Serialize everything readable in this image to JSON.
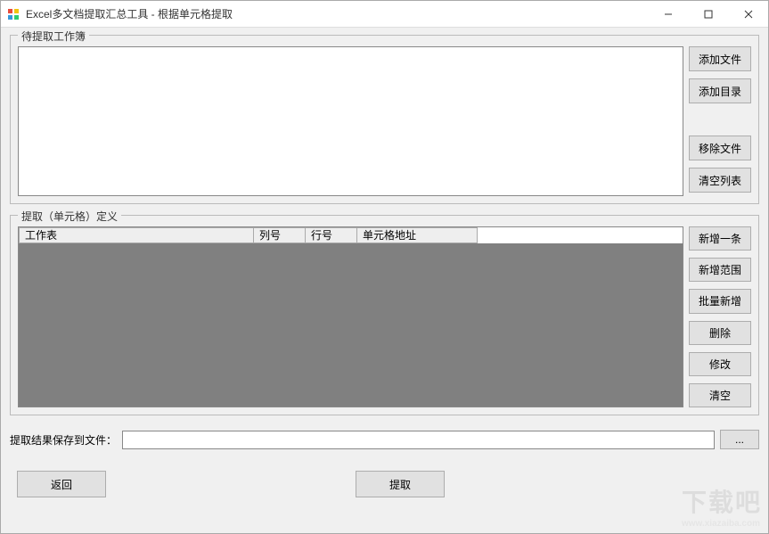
{
  "window": {
    "title": "Excel多文档提取汇总工具 - 根据单元格提取"
  },
  "group_workbooks": {
    "legend": "待提取工作簿",
    "buttons": {
      "add_file": "添加文件",
      "add_dir": "添加目录",
      "remove_file": "移除文件",
      "clear_list": "清空列表"
    }
  },
  "group_definition": {
    "legend": "提取（单元格）定义",
    "headers": {
      "sheet": "工作表",
      "column": "列号",
      "row": "行号",
      "cell_addr": "单元格地址"
    },
    "buttons": {
      "add_one": "新增一条",
      "add_range": "新增范围",
      "batch_add": "批量新增",
      "delete": "删除",
      "modify": "修改",
      "clear": "清空"
    }
  },
  "save": {
    "label": "提取结果保存到文件：",
    "value": "",
    "browse": "..."
  },
  "bottom": {
    "back": "返回",
    "extract": "提取"
  },
  "watermark": {
    "text": "下载吧",
    "sub": "www.xiazaiba.com"
  }
}
